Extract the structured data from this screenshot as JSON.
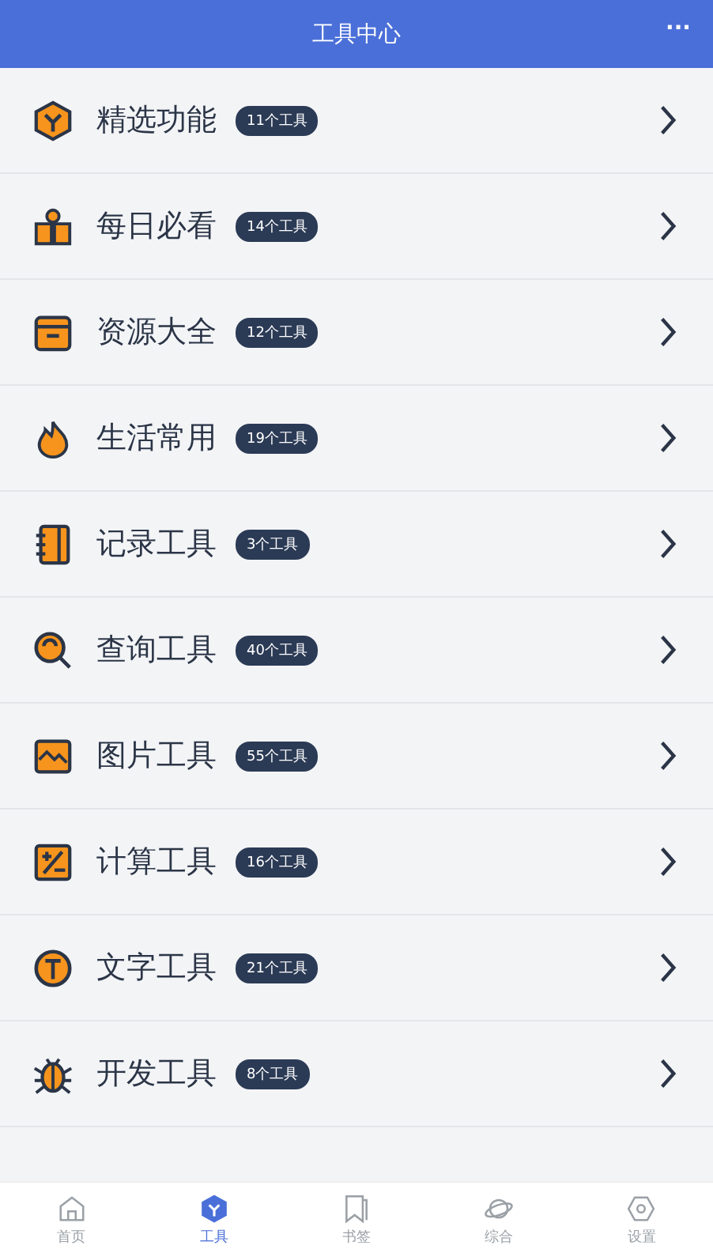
{
  "header": {
    "title": "工具中心",
    "more": "···"
  },
  "categories": [
    {
      "name": "精选功能",
      "count": "11个工具"
    },
    {
      "name": "每日必看",
      "count": "14个工具"
    },
    {
      "name": "资源大全",
      "count": "12个工具"
    },
    {
      "name": "生活常用",
      "count": "19个工具"
    },
    {
      "name": "记录工具",
      "count": "3个工具"
    },
    {
      "name": "查询工具",
      "count": "40个工具"
    },
    {
      "name": "图片工具",
      "count": "55个工具"
    },
    {
      "name": "计算工具",
      "count": "16个工具"
    },
    {
      "name": "文字工具",
      "count": "21个工具"
    },
    {
      "name": "开发工具",
      "count": "8个工具"
    }
  ],
  "tab_bar": [
    {
      "label": "首页",
      "selected": false
    },
    {
      "label": "工具",
      "selected": true
    },
    {
      "label": "书签",
      "selected": false
    },
    {
      "label": "综合",
      "selected": false
    },
    {
      "label": "设置",
      "selected": false
    }
  ]
}
